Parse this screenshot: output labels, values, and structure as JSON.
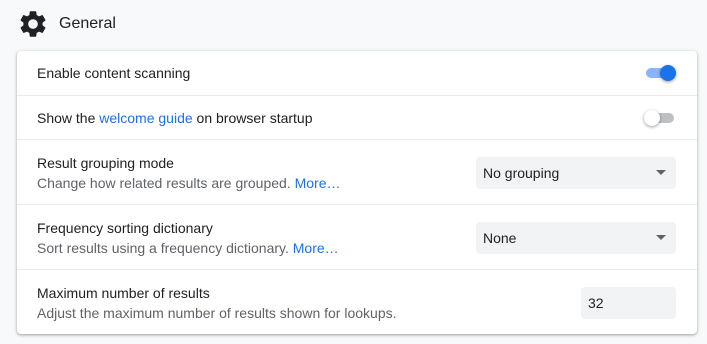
{
  "section": {
    "title": "General",
    "icon": "gear-icon"
  },
  "settings": {
    "enable_scanning": {
      "label": "Enable content scanning",
      "enabled": true
    },
    "welcome_guide": {
      "label_before": "Show the ",
      "link": "welcome guide",
      "label_after": " on browser startup",
      "enabled": false
    },
    "result_grouping": {
      "label": "Result grouping mode",
      "description": "Change how related results are grouped. ",
      "more": "More…",
      "selected": "No grouping"
    },
    "frequency_sorting": {
      "label": "Frequency sorting dictionary",
      "description": "Sort results using a frequency dictionary. ",
      "more": "More…",
      "selected": "None"
    },
    "max_results": {
      "label": "Maximum number of results",
      "description": "Adjust the maximum number of results shown for lookups.",
      "value": "32"
    }
  },
  "colors": {
    "accent": "#1a73e8",
    "toggle_on_track": "#8ab4f8",
    "toggle_off_track": "#bdc1c6",
    "field_background": "#f1f3f4"
  }
}
